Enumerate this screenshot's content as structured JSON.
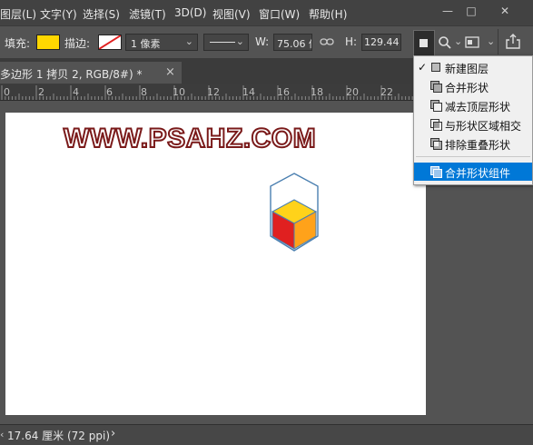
{
  "menu": {
    "items": [
      "图层(L)",
      "文字(Y)",
      "选择(S)",
      "滤镜(T)",
      "3D(D)",
      "视图(V)",
      "窗口(W)",
      "帮助(H)"
    ],
    "window_controls": [
      "—",
      "□",
      "✕"
    ]
  },
  "options": {
    "fill_label": "填充:",
    "fill_color": "#ffd700",
    "stroke_label": "描边:",
    "stroke_width": "1 像素",
    "w_label": "W:",
    "w_value": "75.06 像",
    "h_label": "H:",
    "h_value": "129.44"
  },
  "document": {
    "tab_title": "多边形 1 拷贝 2, RGB/8#) *",
    "tab_close": "×"
  },
  "ruler": {
    "ticks": [
      "0",
      "2",
      "4",
      "6",
      "8",
      "10",
      "12",
      "14",
      "16",
      "18",
      "20",
      "22"
    ]
  },
  "canvas": {
    "watermark": "WWW.PSAHZ.COM",
    "cube_colors": {
      "top": "#ffd21a",
      "left": "#e02020",
      "right": "#ffa21a",
      "outline": "#4a7fb0"
    }
  },
  "status": {
    "text": "17.64 厘米 (72 ppi)",
    "arrow": "›"
  },
  "path_ops_menu": {
    "items": [
      {
        "label": "新建图层",
        "checked": "✓"
      },
      {
        "label": "合并形状"
      },
      {
        "label": "减去顶层形状"
      },
      {
        "label": "与形状区域相交"
      },
      {
        "label": "排除重叠形状"
      },
      {
        "label": "合并形状组件",
        "highlighted": true
      }
    ],
    "highlight_color": "#0078d7"
  }
}
